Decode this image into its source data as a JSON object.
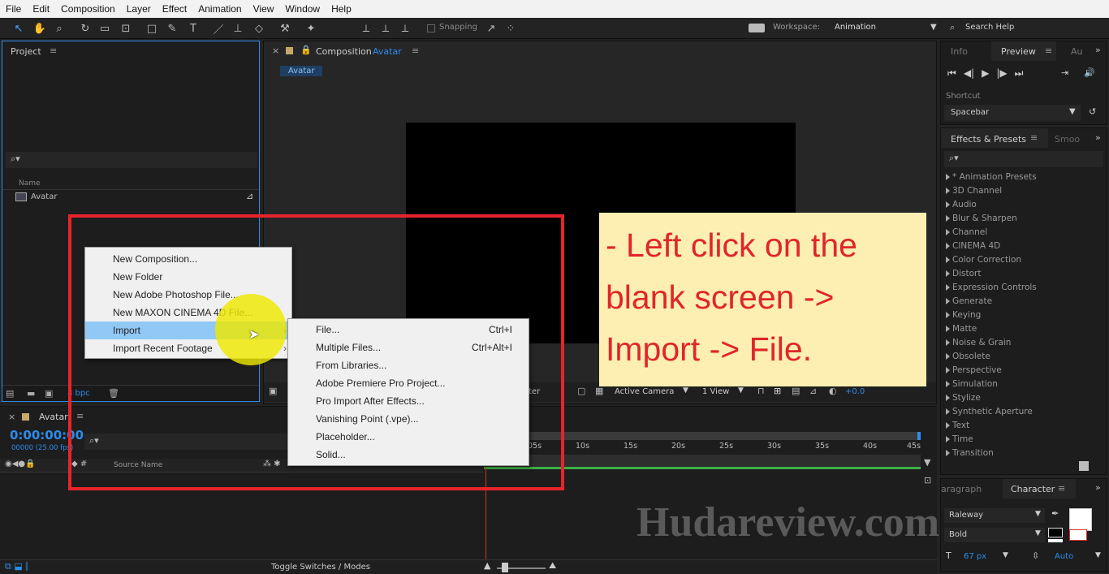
{
  "menu": [
    "File",
    "Edit",
    "Composition",
    "Layer",
    "Effect",
    "Animation",
    "View",
    "Window",
    "Help"
  ],
  "toolbar": {
    "snapping": "Snapping",
    "workspace_label": "Workspace:",
    "workspace_value": "Animation",
    "search_help": "Search Help"
  },
  "project": {
    "title": "Project",
    "name_col": "Name",
    "item": "Avatar",
    "bpc": "8 bpc"
  },
  "composition": {
    "tab_prefix": "Composition",
    "tab_name": "Avatar",
    "flow_tab": "Avatar",
    "camera": "Active Camera",
    "view": "1 View",
    "exposure": "+0.0",
    "partial": "ter"
  },
  "info_panel": {
    "tab_info": "Info",
    "tab_preview": "Preview",
    "tab_audio": "Au",
    "shortcut_label": "Shortcut",
    "shortcut_value": "Spacebar"
  },
  "effects": {
    "tab": "Effects & Presets",
    "tab2": "Smoo",
    "items": [
      "* Animation Presets",
      "3D Channel",
      "Audio",
      "Blur & Sharpen",
      "Channel",
      "CINEMA 4D",
      "Color Correction",
      "Distort",
      "Expression Controls",
      "Generate",
      "Keying",
      "Matte",
      "Noise & Grain",
      "Obsolete",
      "Perspective",
      "Simulation",
      "Stylize",
      "Synthetic Aperture",
      "Text",
      "Time",
      "Transition"
    ]
  },
  "character": {
    "tab_paragraph": "aragraph",
    "tab_character": "Character",
    "font": "Raleway",
    "style": "Bold",
    "size": "67 px",
    "leading": "Auto"
  },
  "timeline": {
    "tab": "Avatar",
    "timecode": "0:00:00:00",
    "fps": "00000 (25.00 fps)",
    "source_name": "Source Name",
    "toggle": "Toggle Switches / Modes",
    "ticks": [
      "05s",
      "10s",
      "15s",
      "20s",
      "25s",
      "30s",
      "35s",
      "40s",
      "45s"
    ]
  },
  "context_menu": {
    "items": [
      "New Composition...",
      "New Folder",
      "New Adobe Photoshop File...",
      "New MAXON CINEMA 4D File...",
      "Import",
      "Import Recent Footage"
    ]
  },
  "submenu": {
    "items": [
      {
        "label": "File...",
        "shortcut": "Ctrl+I"
      },
      {
        "label": "Multiple Files...",
        "shortcut": "Ctrl+Alt+I"
      },
      {
        "label": "From Libraries...",
        "shortcut": ""
      },
      {
        "label": "Adobe Premiere Pro Project...",
        "shortcut": ""
      },
      {
        "label": "Pro Import After Effects...",
        "shortcut": ""
      },
      {
        "label": "Vanishing Point (.vpe)...",
        "shortcut": ""
      },
      {
        "label": "Placeholder...",
        "shortcut": ""
      },
      {
        "label": "Solid...",
        "shortcut": ""
      }
    ]
  },
  "annotation": {
    "line1": "- Left click on the",
    "line2": "blank screen ->",
    "line3": "Import -> File."
  },
  "watermark": "Hudareview.com",
  "colors": {
    "accent_blue": "#2d8ceb",
    "highlight": "#90c8f6",
    "annotation_bg": "#fdefb2",
    "annotation_text": "#e0262a",
    "frame_red": "#e8242a"
  }
}
